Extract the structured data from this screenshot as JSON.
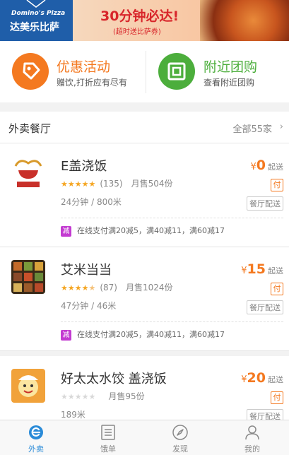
{
  "banner": {
    "brand_en": "Domino's Pizza",
    "brand_cn": "达美乐比萨",
    "headline": "30分钟必达!",
    "subline": "(超时送比萨券)"
  },
  "promos": [
    {
      "title": "优惠活动",
      "desc": "赠饮,打折应有尽有",
      "color": "#f47920",
      "icon": "tag-icon"
    },
    {
      "title": "附近团购",
      "desc": "查看附近团购",
      "color": "#4cae3c",
      "icon": "group-buy-icon"
    }
  ],
  "section": {
    "title": "外卖餐厅",
    "all_label": "全部55家",
    "arrow": "›"
  },
  "restaurants": [
    {
      "name": "E盖浇饭",
      "stars": 5,
      "reviews": "(135)",
      "monthly_sales": "月售504份",
      "time_distance": "24分钟 / 800米",
      "currency": "¥",
      "min_price": "0",
      "min_label": "起送",
      "pay_badge": "付",
      "delivery": "餐厅配送",
      "promo_badge": "减",
      "promo_text": "在线支付满20减5，满40减11，满60减17"
    },
    {
      "name": "艾米当当",
      "stars": 4.5,
      "reviews": "(87)",
      "monthly_sales": "月售1024份",
      "time_distance": "47分钟 / 46米",
      "currency": "¥",
      "min_price": "15",
      "min_label": "起送",
      "pay_badge": "付",
      "delivery": "餐厅配送",
      "promo_badge": "减",
      "promo_text": "在线支付满20减5，满40减11，满60减17"
    },
    {
      "name": "好太太水饺 盖浇饭",
      "stars": 0,
      "reviews": "",
      "monthly_sales": "月售95份",
      "time_distance": "189米",
      "currency": "¥",
      "min_price": "20",
      "min_label": "起送",
      "pay_badge": "付",
      "delivery": "餐厅配送"
    }
  ],
  "tabs": [
    {
      "label": "外卖",
      "icon": "takeout-e-icon",
      "active": true
    },
    {
      "label": "饿单",
      "icon": "order-list-icon",
      "active": false
    },
    {
      "label": "发现",
      "icon": "compass-icon",
      "active": false
    },
    {
      "label": "我的",
      "icon": "user-icon",
      "active": false
    }
  ],
  "colors": {
    "accent": "#f47920",
    "active_tab": "#2a8bd8",
    "green": "#4cae3c",
    "promo_purple": "#c33bd1"
  }
}
